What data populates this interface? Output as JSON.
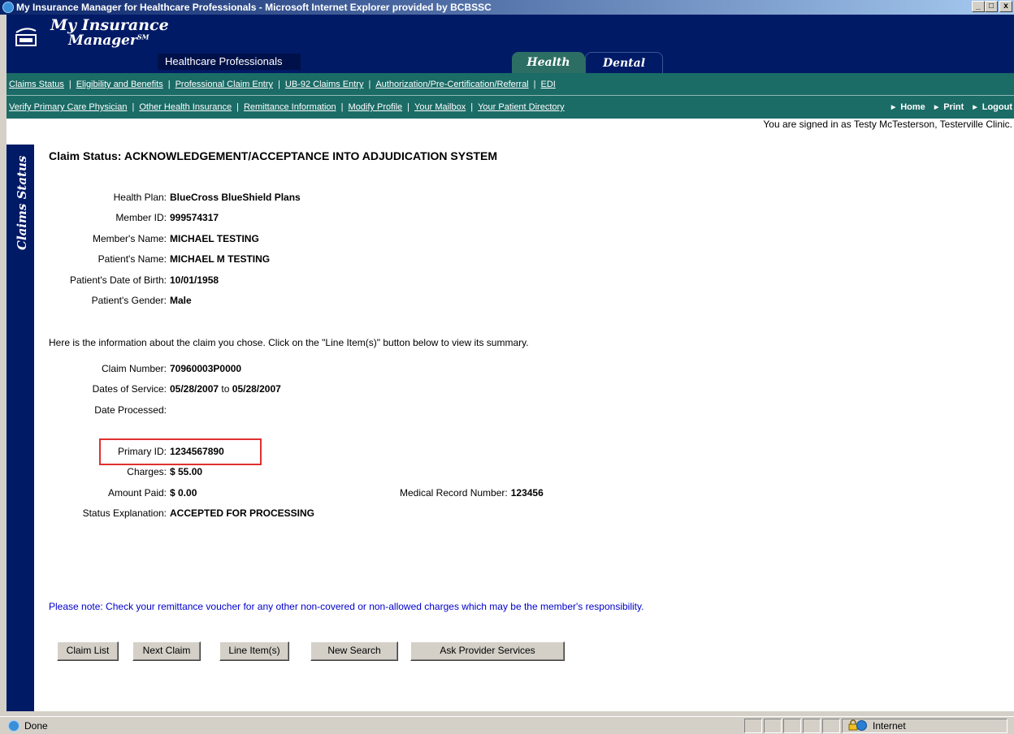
{
  "window": {
    "title": "My Insurance Manager for Healthcare Professionals - Microsoft Internet Explorer provided by BCBSSC",
    "min": "_",
    "max": "□",
    "close": "x"
  },
  "header": {
    "logo_line1": "My Insurance",
    "logo_line2": "Manager",
    "logo_sup": "SM",
    "subtitle": "Healthcare Professionals",
    "tabs": [
      {
        "label": "Health"
      },
      {
        "label": "Dental"
      }
    ]
  },
  "nav": {
    "row1": [
      "Claims Status",
      "Eligibility and Benefits",
      "Professional Claim Entry",
      "UB-92 Claims Entry",
      "Authorization/Pre-Certification/Referral",
      "EDI"
    ],
    "row2": [
      "Verify Primary Care Physician",
      "Other Health Insurance",
      "Remittance Information",
      "Modify Profile",
      "Your Mailbox",
      "Your Patient Directory"
    ],
    "separator": "|",
    "top_links": [
      "Home",
      "Print",
      "Logout"
    ]
  },
  "signed_in": "You are signed in as Testy McTesterson, Testerville Clinic.",
  "sidebar_label": "Claims Status",
  "claim": {
    "title": "Claim Status: ACKNOWLEDGEMENT/ACCEPTANCE INTO ADJUDICATION SYSTEM",
    "member": {
      "health_plan_label": "Health Plan:",
      "health_plan": "BlueCross BlueShield Plans",
      "member_id_label": "Member ID:",
      "member_id": "999574317",
      "member_name_label": "Member's Name:",
      "member_name": "MICHAEL TESTING",
      "patient_name_label": "Patient's Name:",
      "patient_name": "MICHAEL M TESTING",
      "dob_label": "Patient's Date of Birth:",
      "dob": "10/01/1958",
      "gender_label": "Patient's Gender:",
      "gender": "Male"
    },
    "info_text": "Here is the information about the claim you chose. Click on the \"Line Item(s)\" button below to view its summary.",
    "details": {
      "claim_number_label": "Claim Number:",
      "claim_number": "70960003P0000",
      "dates_label": "Dates of Service:",
      "date_from": "05/28/2007",
      "date_to_word": "to",
      "date_to": "05/28/2007",
      "date_processed_label": "Date Processed:",
      "date_processed": "",
      "primary_id_label": "Primary ID:",
      "primary_id": "1234567890",
      "charges_label": "Charges:",
      "charges": "$ 55.00",
      "amount_paid_label": "Amount Paid:",
      "amount_paid": "$ 0.00",
      "mrn_label": "Medical Record Number:",
      "mrn": "123456",
      "status_label": "Status Explanation:",
      "status": "ACCEPTED FOR PROCESSING"
    },
    "note": "Please note: Check your remittance voucher for any other non-covered or non-allowed charges which may be the member's responsibility."
  },
  "buttons": {
    "claim_list": "Claim List",
    "next_claim": "Next Claim",
    "line_items": "Line Item(s)",
    "new_search": "New Search",
    "ask_provider": "Ask Provider Services"
  },
  "statusbar": {
    "text": "Done",
    "zone": "Internet"
  }
}
